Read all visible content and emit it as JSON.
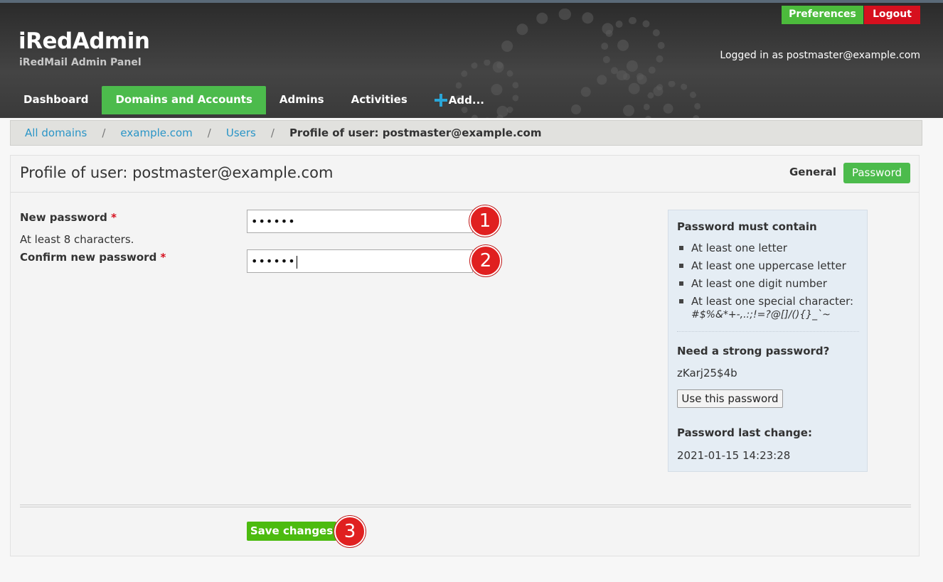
{
  "header": {
    "app_title": "iRedAdmin",
    "app_subtitle": "iRedMail Admin Panel",
    "preferences_label": "Preferences",
    "logout_label": "Logout",
    "logged_in_text": "Logged in as postmaster@example.com"
  },
  "nav": {
    "items": [
      {
        "label": "Dashboard"
      },
      {
        "label": "Domains and Accounts",
        "active": true
      },
      {
        "label": "Admins"
      },
      {
        "label": "Activities"
      },
      {
        "label": "Add...",
        "icon": "plus-icon"
      }
    ]
  },
  "breadcrumb": {
    "items": [
      {
        "label": "All domains"
      },
      {
        "label": "example.com"
      },
      {
        "label": "Users"
      }
    ],
    "separator": "/",
    "current": "Profile of user: postmaster@example.com"
  },
  "panel": {
    "title": "Profile of user: postmaster@example.com",
    "tabs": [
      {
        "label": "General"
      },
      {
        "label": "Password",
        "active": true
      }
    ]
  },
  "form": {
    "new_password_label": "New password",
    "required_mark": "*",
    "new_password_hint": "At least 8 characters.",
    "new_password_value": "••••••",
    "confirm_password_label": "Confirm new password",
    "confirm_password_value": "••••••",
    "save_label": "Save changes"
  },
  "rules": {
    "title": "Password must contain",
    "items": [
      "At least one letter",
      "At least one uppercase letter",
      "At least one digit number",
      "At least one special character:"
    ],
    "special_chars": "#$%&*+-,.:;!=?@[]/(){}_`~",
    "strong_title": "Need a strong password?",
    "generated_password": "zKarj25$4b",
    "use_button": "Use this password",
    "last_change_title": "Password last change:",
    "last_change_date": "2021-01-15 14:23:28"
  },
  "annotations": [
    "1",
    "2",
    "3"
  ],
  "colors": {
    "accent_green": "#4cbb4c",
    "logout_red": "#d6101e",
    "link_blue": "#2a95c7",
    "badge_red": "#e02020"
  }
}
